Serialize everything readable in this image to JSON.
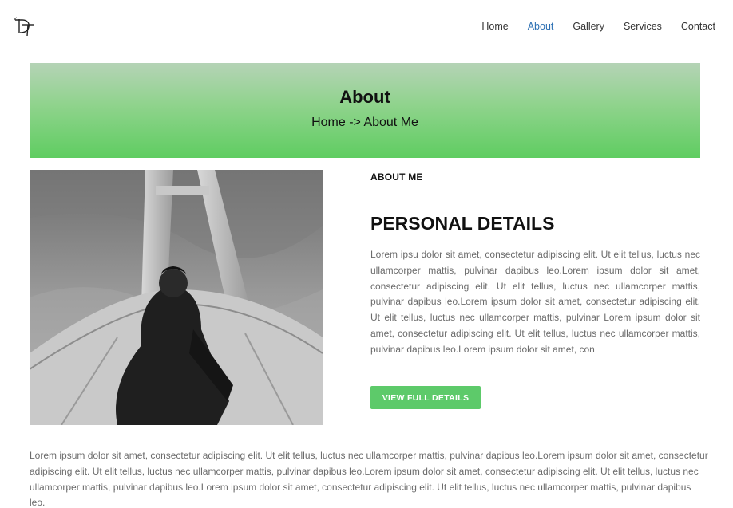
{
  "header": {
    "logo_text": "DT",
    "nav": [
      {
        "label": "Home",
        "active": false
      },
      {
        "label": "About",
        "active": true
      },
      {
        "label": "Gallery",
        "active": false
      },
      {
        "label": "Services",
        "active": false
      },
      {
        "label": "Contact",
        "active": false
      }
    ]
  },
  "banner": {
    "title": "About",
    "breadcrumb": "Home -> About Me"
  },
  "content": {
    "label": "ABOUT ME",
    "title": "PERSONAL DETAILS",
    "paragraph": "Lorem ipsu dolor sit amet, consectetur adipiscing elit. Ut elit tellus, luctus nec ullamcorper mattis, pulvinar dapibus leo.Lorem ipsum dolor sit amet, consectetur adipiscing elit. Ut elit tellus, luctus nec ullamcorper mattis, pulvinar dapibus leo.Lorem ipsum dolor sit amet, consectetur adipiscing elit. Ut elit tellus, luctus nec ullamcorper mattis, pulvinar  Lorem ipsum dolor sit amet, consectetur adipiscing elit. Ut elit tellus, luctus nec ullamcorper mattis, pulvinar dapibus leo.Lorem ipsum dolor sit amet, con",
    "button_label": "VIEW FULL DETAILS"
  },
  "bottom_paragraph": "Lorem ipsum dolor sit amet, consectetur adipiscing elit. Ut elit tellus, luctus nec ullamcorper mattis, pulvinar dapibus leo.Lorem ipsum dolor sit amet, consectetur adipiscing elit. Ut elit tellus, luctus nec ullamcorper mattis, pulvinar dapibus leo.Lorem ipsum dolor sit amet, consectetur adipiscing elit. Ut elit tellus, luctus nec ullamcorper mattis, pulvinar dapibus leo.Lorem ipsum dolor sit amet, consectetur adipiscing elit. Ut elit tellus, luctus nec ullamcorper mattis, pulvinar dapibus leo.",
  "colors": {
    "accent_green": "#5dca6a",
    "active_nav": "#2b6fb3",
    "banner_top": "#b5d3b6",
    "banner_bottom": "#5fcd61"
  }
}
